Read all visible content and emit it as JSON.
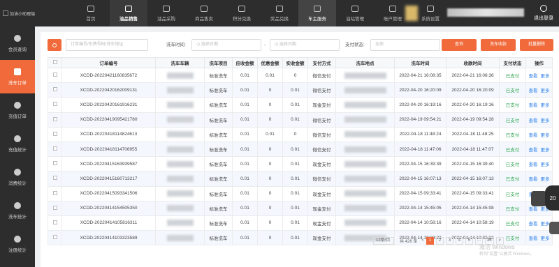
{
  "app": {
    "logo_text": "加油小助理端"
  },
  "nav": [
    {
      "label": "首页",
      "icon": "home-icon"
    },
    {
      "label": "油品销售",
      "icon": "fuel-sale-icon"
    },
    {
      "label": "油品采购",
      "icon": "purchase-icon"
    },
    {
      "label": "商品售卖",
      "icon": "goods-icon"
    },
    {
      "label": "积分兑换",
      "icon": "points-icon"
    },
    {
      "label": "奖品兑换",
      "icon": "gift-icon"
    },
    {
      "label": "车主服务",
      "icon": "car-icon"
    },
    {
      "label": "油站管理",
      "icon": "station-icon"
    },
    {
      "label": "账户管理",
      "icon": "account-icon"
    },
    {
      "label": "系统设置",
      "icon": "settings-icon"
    }
  ],
  "logout_label": "退出登录",
  "sidebar": [
    {
      "label": "会员查询",
      "icon": "user-icon"
    },
    {
      "label": "洗车订单",
      "icon": "order-icon"
    },
    {
      "label": "充值订单",
      "icon": "recharge-icon"
    },
    {
      "label": "充值统计",
      "icon": "pie-icon"
    },
    {
      "label": "消费统计",
      "icon": "stats-icon"
    },
    {
      "label": "洗车统计",
      "icon": "carwash-icon"
    },
    {
      "label": "注册统计",
      "icon": "register-icon"
    }
  ],
  "filters": {
    "keyword_placeholder": "订单编号/车牌号码/洗车地址",
    "time_label": "洗车时间:",
    "start_placeholder": "选择日期",
    "separator": "-",
    "end_placeholder": "选择日期",
    "pay_label": "支付状态:",
    "pay_placeholder": "全部",
    "query_label": "查询",
    "collect_label": "洗车收款",
    "batch_delete_label": "批量删除"
  },
  "table": {
    "headers": [
      "订单编号",
      "洗车车辆",
      "洗车项目",
      "应收金额",
      "优惠金额",
      "实收金额",
      "支付方式",
      "洗车地点",
      "洗车时间",
      "收款时间",
      "支付状态",
      "操作"
    ],
    "view_label": "查看",
    "more_label": "更多",
    "rows": [
      {
        "order": "XCDD-20220421160835672",
        "item": "标准洗车",
        "due": "0.01",
        "discount": "0.01",
        "paid": "0",
        "method": "微信支付",
        "wash_time": "2022-04-21 16:08:35",
        "pay_time": "2022-04-21 16:08:36",
        "status": "已支付"
      },
      {
        "order": "XCDD-20220420162009131",
        "item": "标准洗车",
        "due": "0.01",
        "discount": "0",
        "paid": "0.01",
        "method": "微信支付",
        "wash_time": "2022-04-20 16:20:09",
        "pay_time": "2022-04-20 16:20:09",
        "status": "已支付"
      },
      {
        "order": "XCDD-20220420161916231",
        "item": "标准洗车",
        "due": "0.01",
        "discount": "0",
        "paid": "0.01",
        "method": "现金支付",
        "wash_time": "2022-04-20 16:19:16",
        "pay_time": "2022-04-20 16:19:16",
        "status": "已支付"
      },
      {
        "order": "XCDD-20220419095421780",
        "item": "标准洗车",
        "due": "0.01",
        "discount": "0",
        "paid": "0.01",
        "method": "微信支付",
        "wash_time": "2022-04-19 09:54:21",
        "pay_time": "2022-04-19 09:54:28",
        "status": "已支付"
      },
      {
        "order": "XCDD-20220418114824613",
        "item": "标准洗车",
        "due": "0.01",
        "discount": "0.01",
        "paid": "0",
        "method": "微信支付",
        "wash_time": "2022-04-18 11:48:24",
        "pay_time": "2022-04-18 11:48:25",
        "status": "已支付"
      },
      {
        "order": "XCDD-20220418114706955",
        "item": "标准洗车",
        "due": "0.01",
        "discount": "0",
        "paid": "0.01",
        "method": "微信支付",
        "wash_time": "2022-04-18 11:47:06",
        "pay_time": "2022-04-18 11:47:07",
        "status": "已支付"
      },
      {
        "order": "XCDD-20220415163939587",
        "item": "标准洗车",
        "due": "0.01",
        "discount": "0",
        "paid": "0.01",
        "method": "现金支付",
        "wash_time": "2022-04-15 16:39:39",
        "pay_time": "2022-04-15 16:39:40",
        "status": "已支付"
      },
      {
        "order": "XCDD-20220415160713217",
        "item": "标准洗车",
        "due": "0.01",
        "discount": "0",
        "paid": "0.01",
        "method": "微信支付",
        "wash_time": "2022-04-15 16:07:13",
        "pay_time": "2022-04-15 16:07:13",
        "status": "已支付"
      },
      {
        "order": "XCDD-20220415093341506",
        "item": "标准洗车",
        "due": "0.01",
        "discount": "0",
        "paid": "0.01",
        "method": "现金支付",
        "wash_time": "2022-04-15 09:33:41",
        "pay_time": "2022-04-15 09:33:41",
        "status": "已支付"
      },
      {
        "order": "XCDD-20220414154505350",
        "item": "标准洗车",
        "due": "0.01",
        "discount": "0",
        "paid": "0.01",
        "method": "现金支付",
        "wash_time": "2022-04-14 15:45:05",
        "pay_time": "2022-04-14 15:45:08",
        "status": "已支付"
      },
      {
        "order": "XCDD-20220414105816311",
        "item": "标准洗车",
        "due": "0.01",
        "discount": "0",
        "paid": "0.01",
        "method": "现金支付",
        "wash_time": "2022-04-14 10:58:16",
        "pay_time": "2022-04-14 10:58:19",
        "status": "已支付"
      },
      {
        "order": "XCDD-20220414103323589",
        "item": "标准洗车",
        "due": "0.01",
        "discount": "0",
        "paid": "0.01",
        "method": "现金支付",
        "wash_time": "2022-04-14 10:33:23",
        "pay_time": "2022-04-14 10:33:23",
        "status": "已支付"
      }
    ]
  },
  "pager": {
    "page_size": "12条/页",
    "total": "共 426 条",
    "pages": [
      "1",
      "2",
      "3",
      "4",
      "5",
      "...",
      "36"
    ],
    "next": ">"
  },
  "watermark": {
    "line1": "激活 Windows",
    "line2": "转到\"设置\"以激活 Windows。"
  },
  "float_badge": "20",
  "colors": {
    "accent": "#f06a3b",
    "nav_bg": "#2d2d2d",
    "paid": "#2ea44f",
    "link": "#2b7de9"
  }
}
